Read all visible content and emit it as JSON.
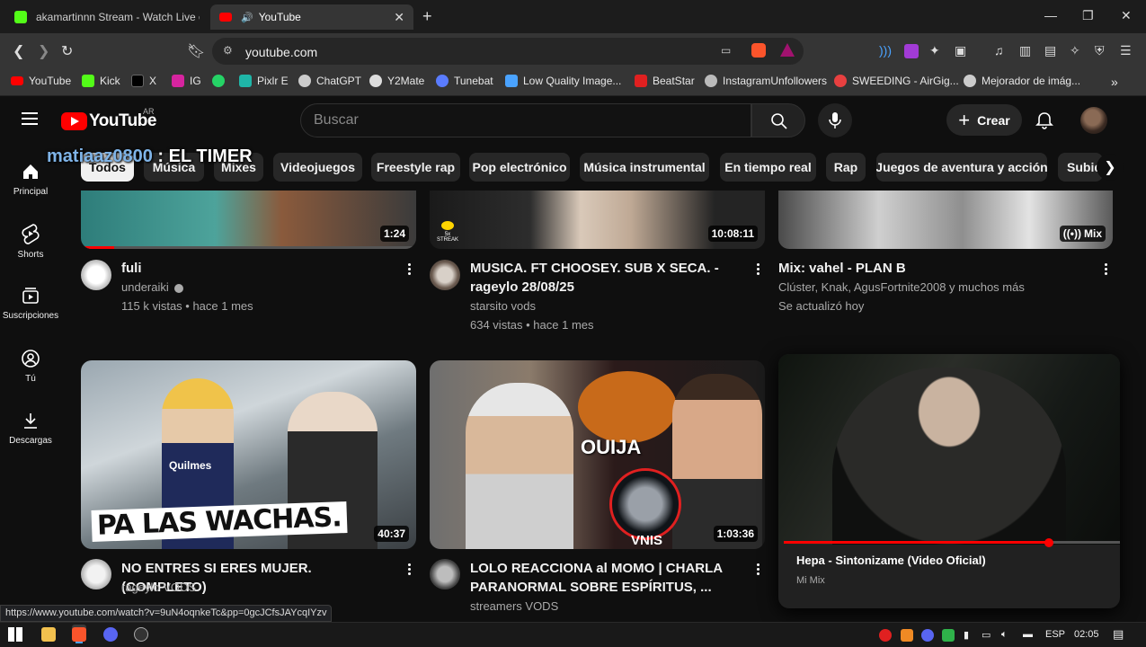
{
  "browser": {
    "tabs": [
      {
        "title": "akamartinnn Stream - Watch Live on Kick",
        "favicon_color": "#53fc18"
      },
      {
        "title": "YouTube",
        "favicon_color": "#ff0000",
        "audio": "🔊"
      }
    ],
    "url": "youtube.com",
    "bookmarks": [
      {
        "label": "YouTube",
        "color": "#ff0000"
      },
      {
        "label": "Kick",
        "color": "#53fc18"
      },
      {
        "label": "X",
        "color": "#ffffff"
      },
      {
        "label": "IG",
        "color": "#d6249f"
      },
      {
        "label": "",
        "color": "#25d366"
      },
      {
        "label": "Pixlr E",
        "color": "#1fb6a8"
      },
      {
        "label": "ChatGPT",
        "color": "#cccccc"
      },
      {
        "label": "Y2Mate",
        "color": "#dddddd"
      },
      {
        "label": "Tunebat",
        "color": "#5a7cff"
      },
      {
        "label": "Low Quality Image...",
        "color": "#4aa3ff"
      },
      {
        "label": "BeatStar",
        "color": "#e02020"
      },
      {
        "label": "InstagramUnfollowers",
        "color": "#bbbbbb"
      },
      {
        "label": "SWEEDING - AirGig...",
        "color": "#e84040"
      },
      {
        "label": "Mejorador de imág...",
        "color": "#cccccc"
      }
    ],
    "more_bookmarks": "»"
  },
  "youtube": {
    "logo_text": "YouTube",
    "country": "AR",
    "search_placeholder": "Buscar",
    "create_label": "Crear",
    "chips": [
      "Todos",
      "Música",
      "Mixes",
      "Videojuegos",
      "Freestyle rap",
      "Pop electrónico",
      "Música instrumental",
      "En tiempo real",
      "Rap",
      "Juegos de aventura y acción",
      "Subid"
    ],
    "overlay_chat": {
      "user": "matiaaz0800",
      "message": " : EL TIMER"
    },
    "guide": [
      "Principal",
      "Shorts",
      "Suscripciones",
      "Tú",
      "Descargas"
    ],
    "videos_row1": [
      {
        "title": "fuli",
        "channel": "underaiki",
        "stats": "115 k vistas • hace 1 mes",
        "duration": "1:24"
      },
      {
        "title": "MUSICA. FT CHOOSEY. SUB X SECA. - rageylo 28/08/25",
        "channel": "starsito vods",
        "stats": "634 vistas • hace 1 mes",
        "duration": "10:08:11",
        "badge": "5x STREAK"
      },
      {
        "title": "Mix: vahel - PLAN B",
        "channel": "Clúster, Knak, AgusFortnite2008 y muchos más",
        "stats": "Se actualizó hoy",
        "duration": "Mix"
      }
    ],
    "videos_row2": [
      {
        "title": "NO ENTRES SI ERES MUJER. (COMPLETO)",
        "channel": "rageylo VODS",
        "stats": "",
        "duration": "40:37",
        "thumb_text": "PA LAS WACHAS.",
        "jersey": "Quilmes"
      },
      {
        "title": "LOLO REACCIONA al MOMO | CHARLA PARANORMAL SOBRE ESPÍRITUS, ...",
        "channel": "streamers VODS",
        "stats": "",
        "duration": "1:03:36",
        "thumb_text": "OUIJA",
        "thumb_text2": "VNIS"
      }
    ],
    "miniplayer": {
      "title": "Hepa - Sintonizame (Video Oficial)",
      "subtitle": "Mi Mix",
      "progress": 0.79
    }
  },
  "status_url": "https://www.youtube.com/watch?v=9uN4oqnkeTc&pp=0gcJCfsJAYcqIYzv",
  "taskbar": {
    "lang": "ESP",
    "time": "02:05"
  }
}
